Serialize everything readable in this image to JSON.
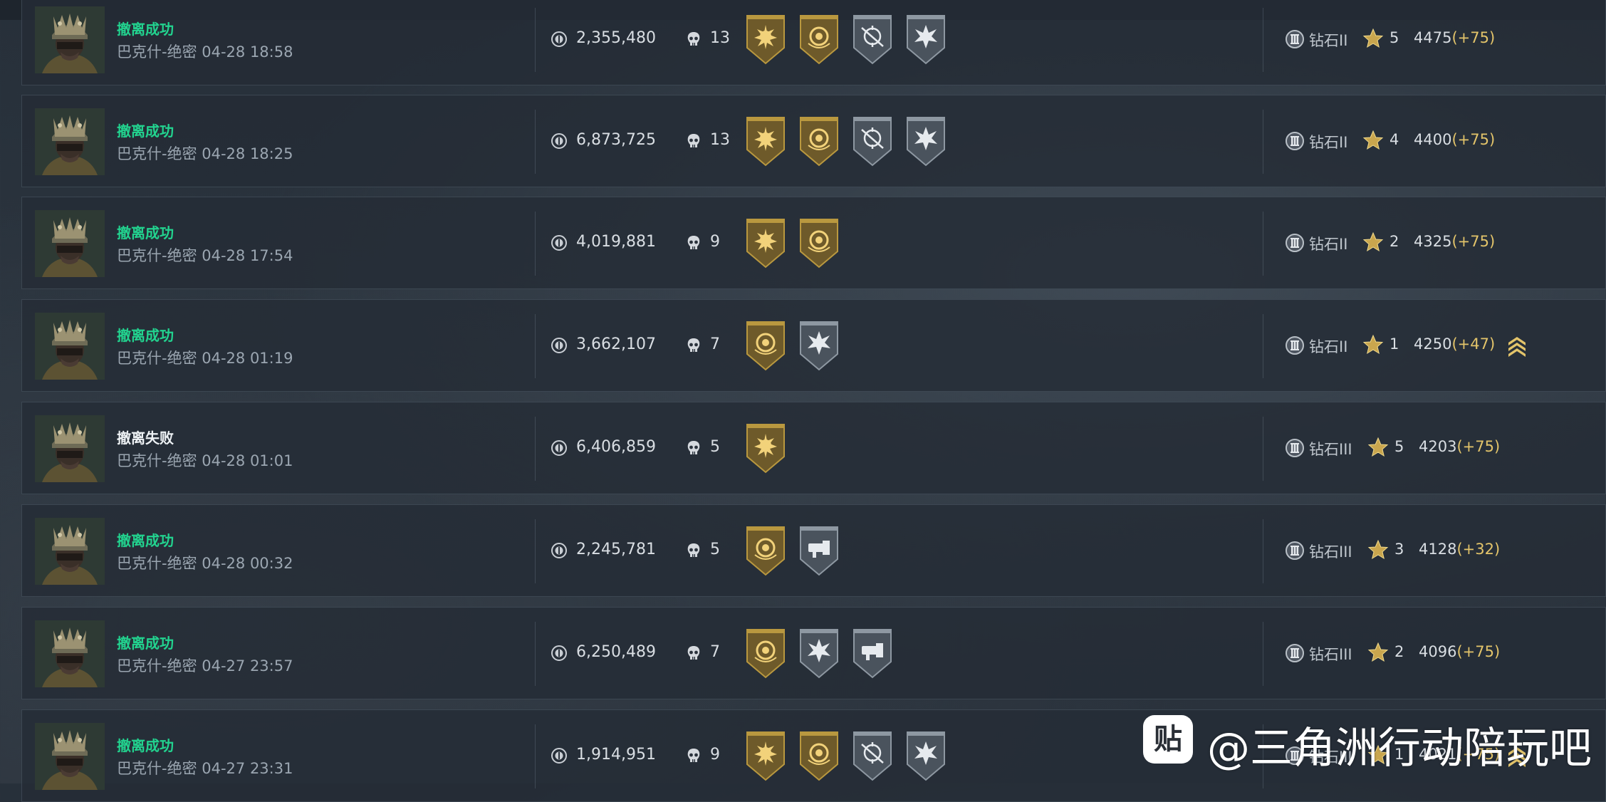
{
  "rows": [
    {
      "status": "撤离成功",
      "status_type": "ok",
      "meta": "巴克什-绝密 04-28 18:58",
      "value": "2,355,480",
      "kills": "13",
      "badges": [
        "gold-sun",
        "gold-coin",
        "silver-target",
        "silver-burst"
      ],
      "rank": "钻石II",
      "stars": "5",
      "score": "4475",
      "delta": "(+75)",
      "promoted": false
    },
    {
      "status": "撤离成功",
      "status_type": "ok",
      "meta": "巴克什-绝密 04-28 18:25",
      "value": "6,873,725",
      "kills": "13",
      "badges": [
        "gold-sun",
        "gold-coin",
        "silver-target",
        "silver-burst"
      ],
      "rank": "钻石II",
      "stars": "4",
      "score": "4400",
      "delta": "(+75)",
      "promoted": false
    },
    {
      "status": "撤离成功",
      "status_type": "ok",
      "meta": "巴克什-绝密 04-28 17:54",
      "value": "4,019,881",
      "kills": "9",
      "badges": [
        "gold-sun",
        "gold-coin"
      ],
      "rank": "钻石II",
      "stars": "2",
      "score": "4325",
      "delta": "(+75)",
      "promoted": false
    },
    {
      "status": "撤离成功",
      "status_type": "ok",
      "meta": "巴克什-绝密 04-28 01:19",
      "value": "3,662,107",
      "kills": "7",
      "badges": [
        "gold-coin",
        "silver-burst"
      ],
      "rank": "钻石II",
      "stars": "1",
      "score": "4250",
      "delta": "(+47)",
      "promoted": true
    },
    {
      "status": "撤离失败",
      "status_type": "fail",
      "meta": "巴克什-绝密 04-28 01:01",
      "value": "6,406,859",
      "kills": "5",
      "badges": [
        "gold-sun"
      ],
      "rank": "钻石III",
      "stars": "5",
      "score": "4203",
      "delta": "(+75)",
      "promoted": false
    },
    {
      "status": "撤离成功",
      "status_type": "ok",
      "meta": "巴克什-绝密 04-28 00:32",
      "value": "2,245,781",
      "kills": "5",
      "badges": [
        "gold-coin",
        "silver-hammer"
      ],
      "rank": "钻石III",
      "stars": "3",
      "score": "4128",
      "delta": "(+32)",
      "promoted": false
    },
    {
      "status": "撤离成功",
      "status_type": "ok",
      "meta": "巴克什-绝密 04-27 23:57",
      "value": "6,250,489",
      "kills": "7",
      "badges": [
        "gold-coin",
        "silver-burst",
        "silver-hammer"
      ],
      "rank": "钻石III",
      "stars": "2",
      "score": "4096",
      "delta": "(+75)",
      "promoted": false
    },
    {
      "status": "撤离成功",
      "status_type": "ok",
      "meta": "巴克什-绝密 04-27 23:31",
      "value": "1,914,951",
      "kills": "9",
      "badges": [
        "gold-sun",
        "gold-coin",
        "silver-target",
        "silver-burst"
      ],
      "rank": "钻石III",
      "stars": "1",
      "score": "4021",
      "delta": "(+75)",
      "promoted": true
    }
  ],
  "watermark": {
    "logo": "贴",
    "text": "@三角洲行动陪玩吧"
  },
  "colors": {
    "success": "#22d38f",
    "gold": "#e3c46a",
    "row_bg": "#242c36"
  }
}
